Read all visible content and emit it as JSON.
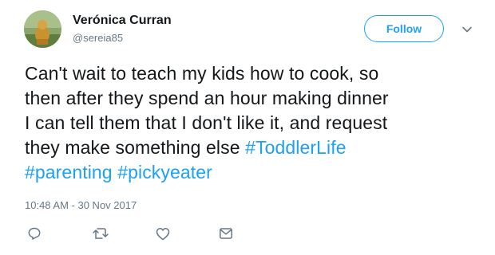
{
  "user": {
    "display_name": "Verónica Curran",
    "username": "@sereia85",
    "avatar_icon": "avatar-image"
  },
  "follow_button": {
    "label": "Follow"
  },
  "tweet": {
    "lines": [
      "Can't wait to teach my kids how to cook, so",
      "then after they spend an hour making dinner",
      "I can tell them that I don't like it, and request",
      "they make something else "
    ],
    "hashtags": [
      "#ToddlerLife",
      "#parenting",
      "#pickyeater"
    ],
    "timestamp": "10:48 AM - 30 Nov 2017"
  },
  "actions": [
    {
      "name": "reply",
      "icon": "reply-icon"
    },
    {
      "name": "retweet",
      "icon": "retweet-icon"
    },
    {
      "name": "like",
      "icon": "heart-icon"
    },
    {
      "name": "direct-message",
      "icon": "envelope-icon"
    }
  ],
  "colors": {
    "accent": "#1da1f2",
    "text": "#14171a",
    "secondary": "#657786",
    "icon": "#657786"
  }
}
